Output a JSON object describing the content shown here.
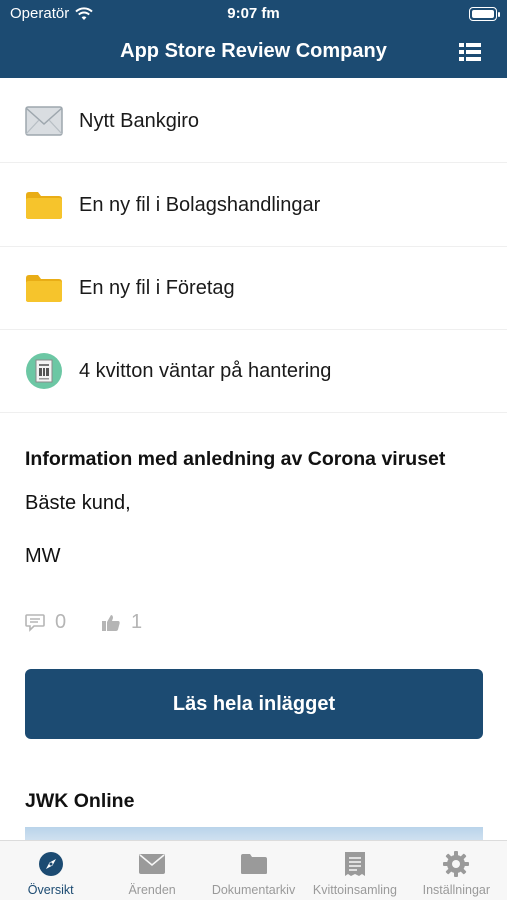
{
  "status_bar": {
    "carrier": "Operatör",
    "time": "9:07 fm"
  },
  "nav": {
    "title": "App Store Review Company",
    "menu_icon": "list-icon"
  },
  "notifications": [
    {
      "label": "Nytt Bankgiro",
      "icon": "envelope-icon"
    },
    {
      "label": "En ny fil i Bolagshandlingar",
      "icon": "folder-icon"
    },
    {
      "label": "En ny fil i Företag",
      "icon": "folder-icon"
    },
    {
      "label": "4 kvitton väntar på hantering",
      "icon": "receipt-icon"
    }
  ],
  "post": {
    "title": "Information med anledning av Corona viruset",
    "greeting": "Bäste kund,",
    "signature": "MW",
    "comments": "0",
    "likes": "1",
    "read_more_label": "Läs hela inlägget"
  },
  "next_section": {
    "title": "JWK Online"
  },
  "tabs": [
    {
      "label": "Översikt",
      "icon": "compass-icon",
      "active": true
    },
    {
      "label": "Ärenden",
      "icon": "envelope-icon",
      "active": false
    },
    {
      "label": "Dokumentarkiv",
      "icon": "folder-icon",
      "active": false
    },
    {
      "label": "Kvittoinsamling",
      "icon": "receipt-icon",
      "active": false
    },
    {
      "label": "Inställningar",
      "icon": "gear-icon",
      "active": false
    }
  ],
  "colors": {
    "brand": "#1c4b72",
    "folder": "#f6c42c",
    "receipt_bg": "#6cc7a4",
    "inactive_tab": "#9a9a9a"
  }
}
